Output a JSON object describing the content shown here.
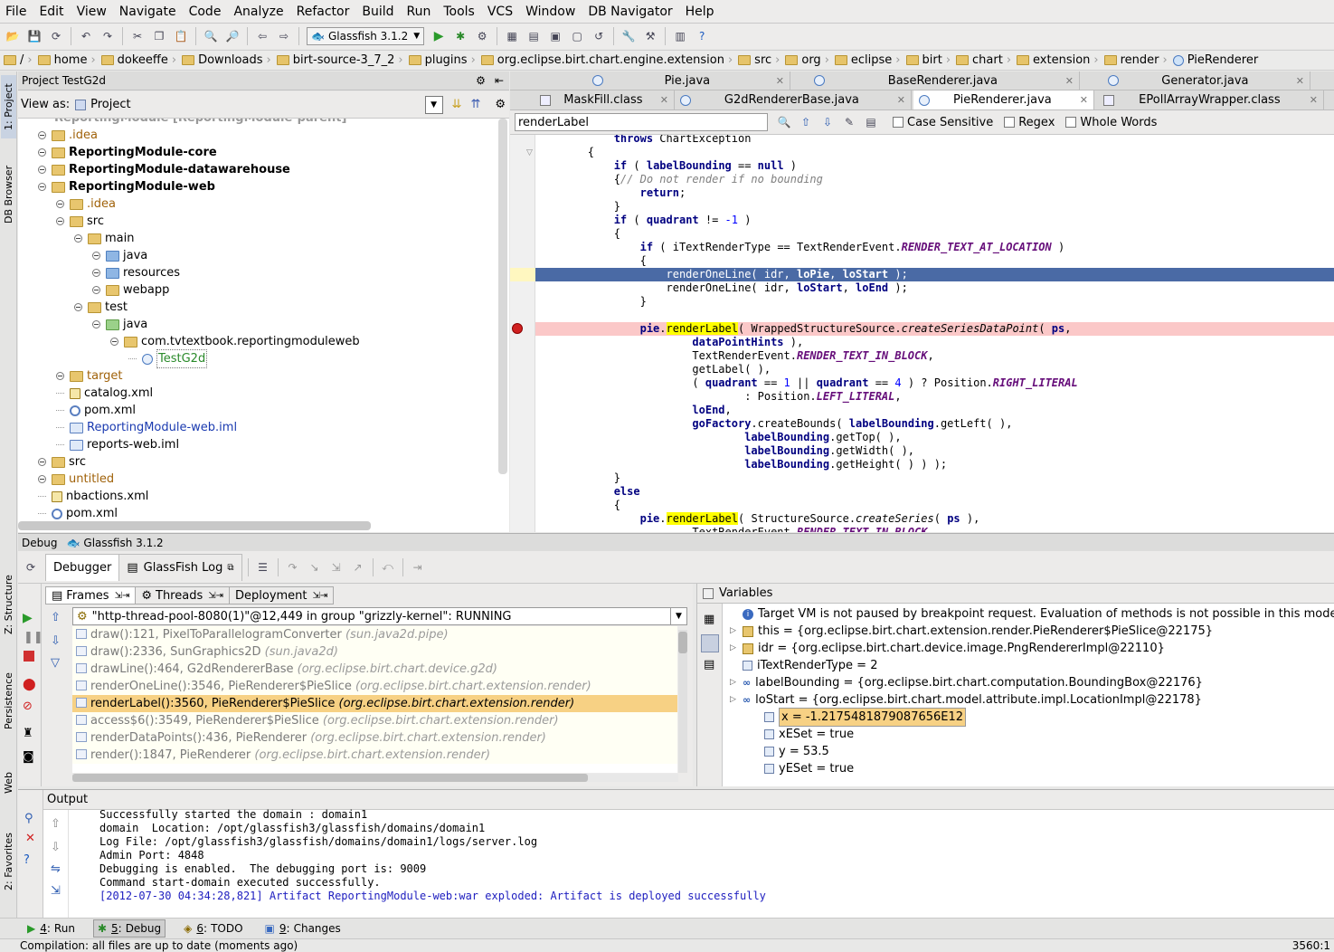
{
  "menu": [
    "File",
    "Edit",
    "View",
    "Navigate",
    "Code",
    "Analyze",
    "Refactor",
    "Build",
    "Run",
    "Tools",
    "VCS",
    "Window",
    "DB Navigator",
    "Help"
  ],
  "toolbar": {
    "run_config": "Glassfish 3.1.2"
  },
  "breadcrumbs": [
    "/",
    "home",
    "dokeeffe",
    "Downloads",
    "birt-source-3_7_2",
    "plugins",
    "org.eclipse.birt.chart.engine.extension",
    "src",
    "org",
    "eclipse",
    "birt",
    "chart",
    "extension",
    "render",
    "PieRenderer"
  ],
  "left_stripe": {
    "project": "1: Project",
    "db_browser": "DB Browser",
    "structure": "Z: Structure",
    "persistence": "Persistence",
    "web": "Web",
    "favorites": "2: Favorites"
  },
  "project_panel": {
    "title": "Project  TestG2d",
    "view_as_label": "View as:",
    "view_as_value": "Project"
  },
  "tree": [
    {
      "label": ".idea",
      "depth": 1,
      "icon": "folder",
      "style": "orange"
    },
    {
      "label": "ReportingModule-core",
      "depth": 1,
      "icon": "folder",
      "style": "bold"
    },
    {
      "label": "ReportingModule-datawarehouse",
      "depth": 1,
      "icon": "folder",
      "style": "bold"
    },
    {
      "label": "ReportingModule-web",
      "depth": 1,
      "icon": "folder",
      "style": "bold"
    },
    {
      "label": ".idea",
      "depth": 2,
      "icon": "folder",
      "style": "orange"
    },
    {
      "label": "src",
      "depth": 2,
      "icon": "folder",
      "style": ""
    },
    {
      "label": "main",
      "depth": 3,
      "icon": "folder",
      "style": ""
    },
    {
      "label": "java",
      "depth": 4,
      "icon": "folder-blue",
      "style": ""
    },
    {
      "label": "resources",
      "depth": 4,
      "icon": "folder-blue",
      "style": ""
    },
    {
      "label": "webapp",
      "depth": 4,
      "icon": "folder",
      "style": ""
    },
    {
      "label": "test",
      "depth": 3,
      "icon": "folder",
      "style": ""
    },
    {
      "label": "java",
      "depth": 4,
      "icon": "folder-green",
      "style": ""
    },
    {
      "label": "com.tvtextbook.reportingmoduleweb",
      "depth": 5,
      "icon": "folder",
      "style": ""
    },
    {
      "label": "TestG2d",
      "depth": 6,
      "icon": "class",
      "style": "green"
    },
    {
      "label": "target",
      "depth": 2,
      "icon": "folder",
      "style": "orange"
    },
    {
      "label": "catalog.xml",
      "depth": 2,
      "icon": "xml",
      "style": ""
    },
    {
      "label": "pom.xml",
      "depth": 2,
      "icon": "pom",
      "style": ""
    },
    {
      "label": "ReportingModule-web.iml",
      "depth": 2,
      "icon": "iml",
      "style": "blue"
    },
    {
      "label": "reports-web.iml",
      "depth": 2,
      "icon": "iml",
      "style": ""
    },
    {
      "label": "src",
      "depth": 1,
      "icon": "folder",
      "style": ""
    },
    {
      "label": "untitled",
      "depth": 1,
      "icon": "folder",
      "style": "orange"
    },
    {
      "label": "nbactions.xml",
      "depth": 1,
      "icon": "xml",
      "style": ""
    },
    {
      "label": "pom.xml",
      "depth": 1,
      "icon": "pom",
      "style": ""
    }
  ],
  "editor_tabs_row1": [
    "Pie.java",
    "BaseRenderer.java",
    "Generator.java"
  ],
  "editor_tabs_row2": [
    "MaskFill.class",
    "G2dRendererBase.java",
    "PieRenderer.java",
    "EPollArrayWrapper.class"
  ],
  "search": {
    "value": "renderLabel",
    "case_sensitive": "Case Sensitive",
    "regex": "Regex",
    "whole_words": "Whole Words"
  },
  "code_lines": [
    "            throws ChartException",
    "        {",
    "            if ( labelBounding == null )",
    "            {// Do not render if no bounding",
    "                return;",
    "            }",
    "            if ( quadrant != -1 )",
    "            {",
    "                if ( iTextRenderType == TextRenderEvent.RENDER_TEXT_AT_LOCATION )",
    "                {",
    "                    renderOneLine( idr, loPie, loStart );",
    "                    renderOneLine( idr, loStart, loEnd );",
    "                }",
    "",
    "                pie.renderLabel( WrappedStructureSource.createSeriesDataPoint( ps,",
    "                        dataPointHints ),",
    "                        TextRenderEvent.RENDER_TEXT_IN_BLOCK,",
    "                        getLabel( ),",
    "                        ( quadrant == 1 || quadrant == 4 ) ? Position.RIGHT_LITERAL",
    "                                : Position.LEFT_LITERAL,",
    "                        loEnd,",
    "                        goFactory.createBounds( labelBounding.getLeft( ),",
    "                                labelBounding.getTop( ),",
    "                                labelBounding.getWidth( ),",
    "                                labelBounding.getHeight( ) ) );",
    "            }",
    "            else",
    "            {",
    "                pie.renderLabel( StructureSource.createSeries( ps ),",
    "                        TextRenderEvent.RENDER_TEXT_IN_BLOCK,"
  ],
  "debug": {
    "header": "Debug",
    "config": "Glassfish 3.1.2",
    "tab_debugger": "Debugger",
    "tab_log": "GlassFish Log",
    "sub_frames": "Frames",
    "sub_threads": "Threads",
    "sub_deployment": "Deployment",
    "thread": "\"http-thread-pool-8080(1)\"@12,449 in group \"grizzly-kernel\": RUNNING",
    "frames": [
      {
        "method": "draw():121, PixelToParallelogramConverter",
        "pkg": "(sun.java2d.pipe)",
        "selected": false
      },
      {
        "method": "draw():2336, SunGraphics2D",
        "pkg": "(sun.java2d)",
        "selected": false
      },
      {
        "method": "drawLine():464, G2dRendererBase",
        "pkg": "(org.eclipse.birt.chart.device.g2d)",
        "selected": false
      },
      {
        "method": "renderOneLine():3546, PieRenderer$PieSlice",
        "pkg": "(org.eclipse.birt.chart.extension.render)",
        "selected": false
      },
      {
        "method": "renderLabel():3560, PieRenderer$PieSlice",
        "pkg": "(org.eclipse.birt.chart.extension.render)",
        "selected": true
      },
      {
        "method": "access$6():3549, PieRenderer$PieSlice",
        "pkg": "(org.eclipse.birt.chart.extension.render)",
        "selected": false
      },
      {
        "method": "renderDataPoints():436, PieRenderer",
        "pkg": "(org.eclipse.birt.chart.extension.render)",
        "selected": false
      },
      {
        "method": "render():1847, PieRenderer",
        "pkg": "(org.eclipse.birt.chart.extension.render)",
        "selected": false
      }
    ],
    "variables_title": "Variables",
    "variables": [
      {
        "text": "Target VM is not paused by breakpoint request. Evaluation of methods is not possible in this mode",
        "depth": 0,
        "expander": false,
        "icon": "info"
      },
      {
        "text": "this = {org.eclipse.birt.chart.extension.render.PieRenderer$PieSlice@22175}",
        "depth": 0,
        "expander": true,
        "icon": "field"
      },
      {
        "text": "idr = {org.eclipse.birt.chart.device.image.PngRendererImpl@22110}",
        "depth": 0,
        "expander": true,
        "icon": "field"
      },
      {
        "text": "iTextRenderType = 2",
        "depth": 0,
        "expander": false,
        "icon": "prim"
      },
      {
        "text": "labelBounding = {org.eclipse.birt.chart.computation.BoundingBox@22176}",
        "depth": 0,
        "expander": true,
        "icon": "oo"
      },
      {
        "text": "loStart = {org.eclipse.birt.chart.model.attribute.impl.LocationImpl@22178}",
        "depth": 0,
        "expander": true,
        "icon": "oo"
      },
      {
        "text": "x = -1.2175481879087656E12",
        "depth": 1,
        "expander": false,
        "icon": "prim",
        "highlight": true
      },
      {
        "text": "xESet = true",
        "depth": 1,
        "expander": false,
        "icon": "prim"
      },
      {
        "text": "y = 53.5",
        "depth": 1,
        "expander": false,
        "icon": "prim"
      },
      {
        "text": "yESet = true",
        "depth": 1,
        "expander": false,
        "icon": "prim"
      }
    ]
  },
  "output": {
    "title": "Output",
    "lines": [
      {
        "text": "Successfully started the domain : domain1",
        "color": "#000000"
      },
      {
        "text": "domain  Location: /opt/glassfish3/glassfish/domains/domain1",
        "color": "#000000"
      },
      {
        "text": "Log File: /opt/glassfish3/glassfish/domains/domain1/logs/server.log",
        "color": "#000000"
      },
      {
        "text": "Admin Port: 4848",
        "color": "#000000"
      },
      {
        "text": "Debugging is enabled.  The debugging port is: 9009",
        "color": "#000000"
      },
      {
        "text": "Command start-domain executed successfully.",
        "color": "#000000"
      },
      {
        "text": "[2012-07-30 04:34:28,821] Artifact ReportingModule-web:war exploded: Artifact is deployed successfully",
        "color": "#2020c0"
      }
    ]
  },
  "bottom_tabs": [
    {
      "num": "4",
      "label": "Run"
    },
    {
      "num": "5",
      "label": "Debug"
    },
    {
      "num": "6",
      "label": "TODO"
    },
    {
      "num": "9",
      "label": "Changes"
    }
  ],
  "status": {
    "message": "Compilation: all files are up to date (moments ago)",
    "position": "3560:1"
  }
}
